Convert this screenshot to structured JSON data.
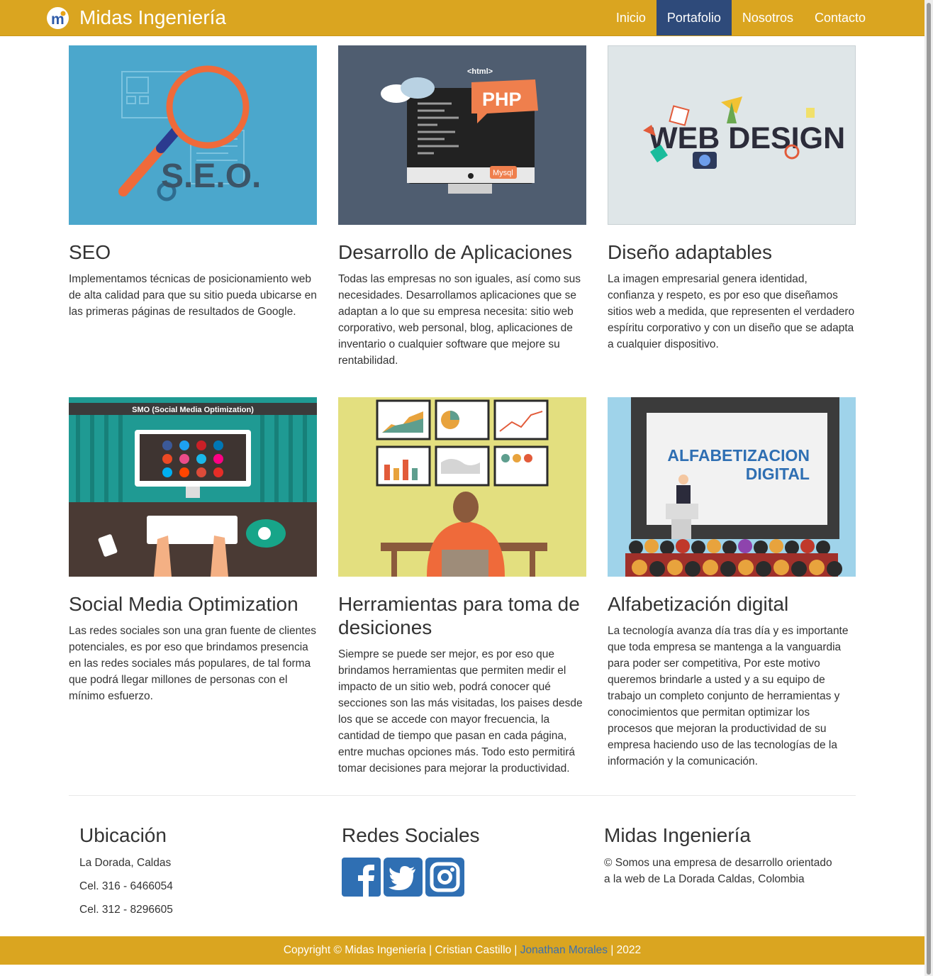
{
  "navbar": {
    "brand": "Midas Ingeniería",
    "logo_letter": "m",
    "items": [
      "Inicio",
      "Portafolio",
      "Nosotros",
      "Contacto"
    ],
    "active_item": "Portafolio"
  },
  "images": {
    "seo": "S.E.O.",
    "php": "PHP",
    "html": "<html>",
    "mysql": "Mysql",
    "webdesign": "WEB DESIGN",
    "smo": "SMO (Social Media Optimization)",
    "alfa1": "ALFABETIZACION",
    "alfa2": "DIGITAL"
  },
  "cards": [
    {
      "title": "SEO",
      "text": "Implementamos técnicas de posicionamiento web de alta calidad para que su sitio pueda ubicarse en las primeras páginas de resultados de Google."
    },
    {
      "title": "Desarrollo de Aplicaciones",
      "text": "Todas las empresas no son iguales, así como sus necesidades. Desarrollamos aplicaciones que se adaptan a lo que su empresa necesita: sitio web corporativo, web personal, blog, aplicaciones de inventario o cualquier software que mejore su rentabilidad."
    },
    {
      "title": "Diseño adaptables",
      "text": "La imagen empresarial genera identidad, confianza y respeto, es por eso que diseñamos sitios web a medida, que representen el verdadero espíritu corporativo y con un diseño que se adapta a cualquier dispositivo."
    },
    {
      "title": "Social Media Optimization",
      "text": "Las redes sociales son una gran fuente de clientes potenciales, es por eso que brindamos presencia en las redes sociales más populares, de tal forma que podrá llegar millones de personas con el mínimo esfuerzo."
    },
    {
      "title": "Herramientas para toma de desiciones",
      "text": "Siempre se puede ser mejor, es por eso que brindamos herramientas que permiten medir el impacto de un sitio web, podrá conocer qué secciones son las más visitadas, los paises desde los que se accede con mayor frecuencia, la cantidad de tiempo que pasan en cada página, entre muchas opciones más. Todo esto permitirá tomar decisiones para mejorar la productividad."
    },
    {
      "title": "Alfabetización digital",
      "text": "La tecnología avanza día tras día y es importante que toda empresa se mantenga a la vanguardia para poder ser competitiva, Por este motivo queremos brindarle a usted y a su equipo de trabajo un completo conjunto de herramientas y conocimientos que permitan optimizar los procesos que mejoran la productividad de su empresa haciendo uso de las tecnologías de la información y la comunicación."
    }
  ],
  "footer": {
    "location": {
      "title": "Ubicación",
      "lines": [
        "La Dorada, Caldas",
        "Cel. 316 - 6466054",
        "Cel. 312 - 8296605"
      ]
    },
    "social": {
      "title": "Redes Sociales",
      "icons": [
        "facebook-icon",
        "twitter-icon",
        "instagram-icon"
      ]
    },
    "about": {
      "title": "Midas Ingeniería",
      "text1": "© Somos una empresa de desarrollo orientado",
      "text2": "a la web de La Dorada Caldas, Colombia"
    }
  },
  "copyright": {
    "prefix": "Copyright © Midas Ingeniería | Cristian Castillo |",
    "link": "Jonathan Morales",
    "suffix": "| 2022"
  },
  "colors": {
    "brand": "#daa520",
    "nav_active": "#2e4a7a",
    "link": "#3a6fb0",
    "social_blue": "#2f6fb3"
  }
}
